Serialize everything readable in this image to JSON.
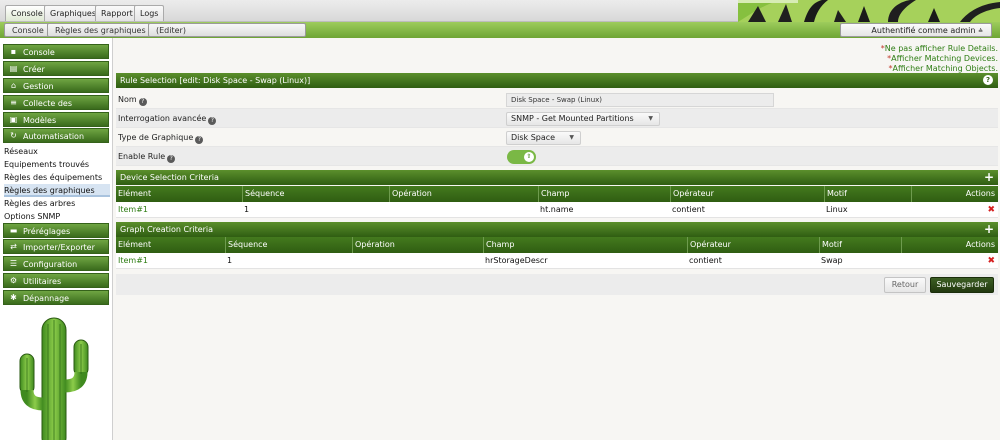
{
  "top_tabs": [
    "Console",
    "Graphiques",
    "Rapport",
    "Logs"
  ],
  "breadcrumb": [
    "Console",
    "Règles des graphiques",
    "(Editer)"
  ],
  "auth": {
    "label": "Authentifié comme admin",
    "caret": "≙"
  },
  "sidebar": {
    "items": [
      {
        "label": "Console",
        "icon": "book-icon",
        "glyph": "▪"
      },
      {
        "label": "Créer",
        "icon": "chart-icon",
        "glyph": "▤"
      },
      {
        "label": "Gestion",
        "icon": "home-icon",
        "glyph": "⌂"
      },
      {
        "label": "Collecte des données",
        "icon": "database-icon",
        "glyph": "≡"
      },
      {
        "label": "Modèles",
        "icon": "template-icon",
        "glyph": "▣"
      },
      {
        "label": "Automatisation",
        "icon": "refresh-icon",
        "glyph": "↻"
      }
    ],
    "automation_sub": [
      "Réseaux",
      "Equipements trouvés",
      "Règles des équipements",
      "Règles des graphiques",
      "Règles des arbres",
      "Options SNMP"
    ],
    "lower_items": [
      {
        "label": "Préréglages",
        "icon": "preset-icon",
        "glyph": "▬"
      },
      {
        "label": "Importer/Exporter",
        "icon": "import-export-icon",
        "glyph": "⇄"
      },
      {
        "label": "Configuration",
        "icon": "sliders-icon",
        "glyph": "☰"
      },
      {
        "label": "Utilitaires",
        "icon": "gears-icon",
        "glyph": "⚙"
      },
      {
        "label": "Dépannage",
        "icon": "bug-icon",
        "glyph": "✱"
      }
    ]
  },
  "notices": [
    {
      "ast": "*",
      "text": "Ne pas afficher Rule Details."
    },
    {
      "ast": "*",
      "text": "Afficher Matching Devices."
    },
    {
      "ast": "*",
      "text": "Afficher Matching Objects."
    }
  ],
  "rule_section": {
    "title": "Rule Selection [edit: Disk Space - Swap (Linux)]",
    "help": "?",
    "fields": {
      "name_label": "Nom",
      "name_value": "Disk Space - Swap (Linux)",
      "query_label": "Interrogation avancée",
      "query_value": "SNMP - Get Mounted Partitions",
      "graphtype_label": "Type de Graphique",
      "graphtype_value": "Disk Space",
      "enable_label": "Enable Rule",
      "enable_knob": "⇧"
    }
  },
  "device_criteria": {
    "title": "Device Selection Criteria",
    "add": "+",
    "columns": [
      "Elément",
      "Séquence",
      "Opération",
      "Champ",
      "Opérateur",
      "Motif",
      "Actions"
    ],
    "rows": [
      {
        "item": "Item#1",
        "sequence": "1",
        "operation": "",
        "field": "ht.name",
        "operator": "contient",
        "pattern": "Linux",
        "delete": "✖"
      }
    ]
  },
  "graph_criteria": {
    "title": "Graph Creation Criteria",
    "add": "+",
    "columns": [
      "Elément",
      "Séquence",
      "Opération",
      "Champ",
      "Opérateur",
      "Motif",
      "Actions"
    ],
    "rows": [
      {
        "item": "Item#1",
        "sequence": "1",
        "operation": "",
        "field": "hrStorageDescr",
        "operator": "contient",
        "pattern": "Swap",
        "delete": "✖"
      }
    ]
  },
  "buttons": {
    "back": "Retour",
    "save": "Sauvegarder"
  },
  "colors": {
    "accent_green": "#2f5d12",
    "link_green": "#2e7d14",
    "delete_red": "#d62020",
    "selected_blue": "#d7e4f2"
  }
}
